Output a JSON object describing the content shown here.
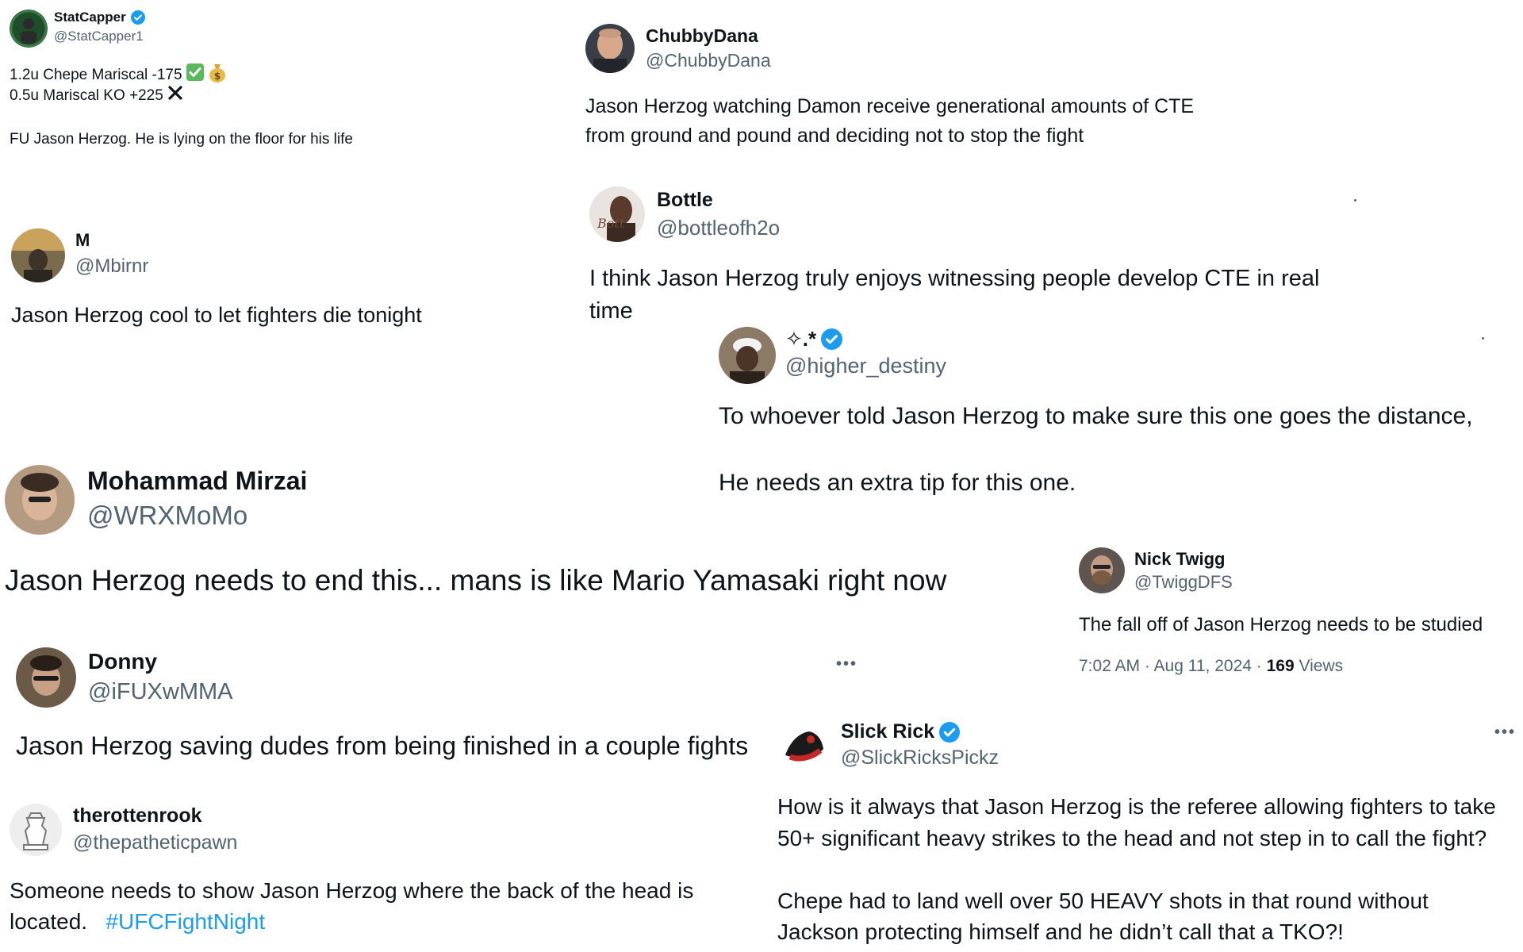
{
  "tweets": {
    "statcapper": {
      "name": "StatCapper",
      "handle": "@StatCapper1",
      "line1": "1.2u Chepe Mariscal -175",
      "line2": "0.5u Mariscal KO +225",
      "line3": "FU Jason Herzog. He is lying on the floor for his life",
      "verified": true
    },
    "chubbydana": {
      "name": "ChubbyDana",
      "handle": "@ChubbyDana",
      "line1": "Jason Herzog watching Damon receive generational amounts of CTE",
      "line2": "from ground and pound and deciding not to stop the fight"
    },
    "m": {
      "name": "M",
      "handle": "@Mbirnr",
      "line1": "Jason Herzog cool to let fighters die tonight"
    },
    "bottle": {
      "name": "Bottle",
      "handle": "@bottleofh2o",
      "line1": "I think Jason Herzog truly enjoys witnessing people develop CTE in real",
      "line2": "time"
    },
    "higher_destiny": {
      "name": "✧.*",
      "handle": "@higher_destiny",
      "line1": "To whoever told Jason Herzog to make sure this one goes the distance,",
      "line2": "He needs an extra tip for this one.",
      "verified": true
    },
    "mirzai": {
      "name": "Mohammad Mirzai",
      "handle": "@WRXMoMo",
      "line1": "Jason Herzog needs to end this... mans is like Mario Yamasaki right now"
    },
    "nicktwigg": {
      "name": "Nick Twigg",
      "handle": "@TwiggDFS",
      "line1": "The fall off of Jason Herzog needs to be studied",
      "time": "7:02 AM · Aug 11, 2024 · ",
      "views_count": "169",
      "views_label": " Views"
    },
    "donny": {
      "name": "Donny",
      "handle": "@iFUXwMMA",
      "line1": "Jason Herzog saving dudes from being finished in a couple fights",
      "more": "•••"
    },
    "slickrick": {
      "name": "Slick Rick",
      "handle": "@SlickRicksPickz",
      "line1": "How is it always that Jason Herzog is the referee allowing fighters to take",
      "line2": "50+ significant heavy strikes to the head and not step in to call the fight?",
      "line3": "Chepe had to land well over 50 HEAVY shots in that round without",
      "line4": "Jackson protecting himself and he didn’t call that a TKO?!",
      "more": "•••",
      "verified": true
    },
    "therottenrook": {
      "name": "therottenrook",
      "handle": "@thepatheticpawn",
      "line1": "Someone needs to show Jason Herzog where the back of the head is",
      "line2": "located.",
      "hashtag": "#UFCFightNight"
    }
  },
  "icons": {
    "verified": "verified-badge-icon",
    "check": "check-mark-emoji-icon",
    "money": "money-bag-emoji-icon",
    "cross": "cross-mark-icon",
    "more": "more-options-icon"
  },
  "colors": {
    "text": "#0f1419",
    "secondary": "#536471",
    "accent": "#1d9bf0",
    "check_green": "#5cb85c"
  }
}
